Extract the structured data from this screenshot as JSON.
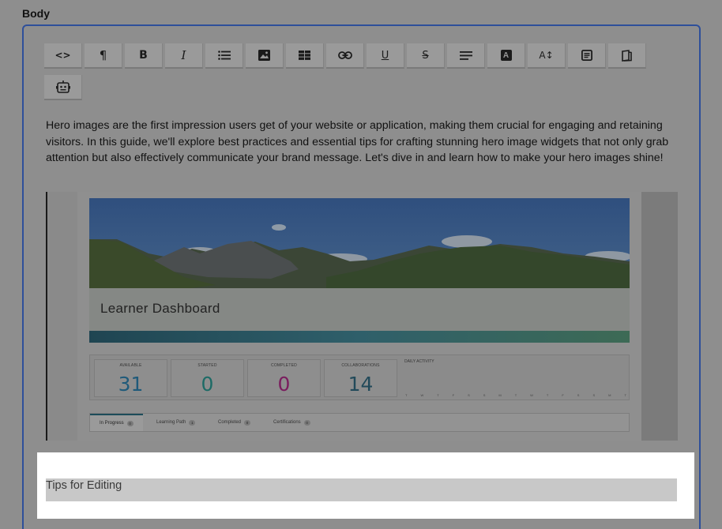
{
  "section": {
    "label": "Body"
  },
  "toolbar": {
    "buttons": [
      {
        "name": "code-view-button",
        "icon": "code-icon",
        "glyph": "<>"
      },
      {
        "name": "paragraph-button",
        "icon": "pilcrow-icon",
        "glyph": "¶"
      },
      {
        "name": "bold-button",
        "icon": "bold-icon",
        "glyph": "B"
      },
      {
        "name": "italic-button",
        "icon": "italic-icon",
        "glyph": "I"
      },
      {
        "name": "bullet-list-button",
        "icon": "bullet-list-icon"
      },
      {
        "name": "insert-image-button",
        "icon": "image-icon"
      },
      {
        "name": "insert-table-button",
        "icon": "table-icon"
      },
      {
        "name": "insert-link-button",
        "icon": "link-icon"
      },
      {
        "name": "underline-button",
        "icon": "underline-icon",
        "glyph": "U"
      },
      {
        "name": "strikethrough-button",
        "icon": "strikethrough-icon",
        "glyph": "S"
      },
      {
        "name": "align-button",
        "icon": "align-left-icon"
      },
      {
        "name": "text-color-button",
        "icon": "text-color-icon",
        "glyph": "A"
      },
      {
        "name": "font-size-button",
        "icon": "font-size-icon",
        "glyph": "A↕"
      },
      {
        "name": "block-format-button",
        "icon": "document-icon"
      },
      {
        "name": "template-button",
        "icon": "page-icon"
      },
      {
        "name": "ai-assistant-button",
        "icon": "robot-icon"
      }
    ]
  },
  "content": {
    "intro": "Hero images are the first impression users get of your website or application, making them crucial for engaging and retaining visitors. In this guide, we'll explore best practices and essential tips for crafting stunning hero image widgets that not only grab attention but also effectively communicate your brand message. Let's dive in and learn how to make your hero images shine!"
  },
  "embed": {
    "hero_title": "Learner Dashboard",
    "stats": [
      {
        "label": "AVAILABLE",
        "value": "31",
        "color": "#1f5a7a",
        "icon": "calendar-icon"
      },
      {
        "label": "STARTED",
        "value": "0",
        "color": "#1d6b66",
        "icon": "briefcase-icon"
      },
      {
        "label": "COMPLETED",
        "value": "0",
        "color": "#7a1d5e",
        "icon": "check-icon"
      },
      {
        "label": "COLLABORATIONS",
        "value": "14",
        "color": "#224a5a",
        "icon": "people-icon"
      }
    ],
    "activity": {
      "title": "DAILY ACTIVITY",
      "days": [
        "T",
        "W",
        "T",
        "F",
        "S",
        "S",
        "M",
        "T",
        "W",
        "T",
        "F",
        "S",
        "S",
        "M",
        "T"
      ]
    },
    "tabs": [
      {
        "label": "In Progress",
        "count": "0"
      },
      {
        "label": "Learning Path",
        "count": "1"
      },
      {
        "label": "Completed",
        "count": "0"
      },
      {
        "label": "Certifications",
        "count": "0"
      }
    ]
  },
  "tips": {
    "label": "Tips for Editing"
  },
  "colors": {
    "border_accent": "#2e4f9a",
    "overlay": "#8e8e8e"
  }
}
